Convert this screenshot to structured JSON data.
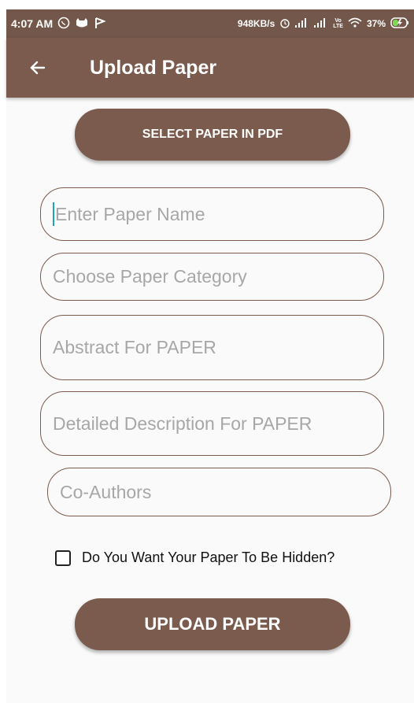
{
  "status_bar": {
    "time": "4:07 AM",
    "network_speed": "948KB/s",
    "volte": "Vo\nLTE",
    "battery": "37%"
  },
  "app_bar": {
    "title": "Upload Paper"
  },
  "buttons": {
    "select_pdf": "SELECT PAPER IN PDF",
    "upload": "UPLOAD PAPER"
  },
  "form": {
    "paper_name_placeholder": "Enter Paper Name",
    "category_placeholder": "Choose Paper Category",
    "abstract_placeholder": "Abstract For PAPER",
    "description_placeholder": "Detailed Description For PAPER",
    "coauthors_placeholder": "Co-Authors",
    "hidden_checkbox_label": "Do You Want Your Paper To Be Hidden?",
    "hidden_checked": false
  },
  "colors": {
    "primary": "#7b5b4e",
    "status_bar": "#72574a",
    "background": "#fafafa",
    "placeholder": "#a7a7a7",
    "caret": "#1aa8b8"
  }
}
